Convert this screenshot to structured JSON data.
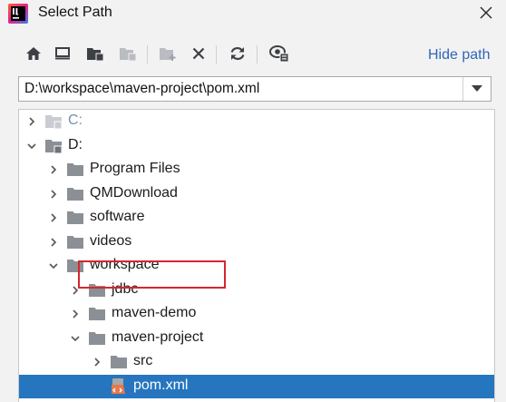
{
  "window": {
    "title": "Select Path",
    "close_icon": "close-icon"
  },
  "toolbar": {
    "buttons": [
      "home-icon",
      "desktop-icon",
      "project-folder-icon",
      "module-folder-icon",
      "new-folder-icon",
      "delete-icon",
      "refresh-icon",
      "show-hidden-icon"
    ],
    "hide_path_label": "Hide path"
  },
  "path_field": {
    "value": "D:\\workspace\\maven-project\\pom.xml"
  },
  "tree": {
    "items": [
      {
        "label": "C:",
        "state": "collapsed",
        "type": "drive",
        "dim": true
      },
      {
        "label": "D:",
        "state": "expanded",
        "type": "drive"
      },
      {
        "label": "Program Files",
        "state": "collapsed",
        "type": "folder"
      },
      {
        "label": "QMDownload",
        "state": "collapsed",
        "type": "folder"
      },
      {
        "label": "software",
        "state": "collapsed",
        "type": "folder"
      },
      {
        "label": "videos",
        "state": "collapsed",
        "type": "folder"
      },
      {
        "label": "workspace",
        "state": "expanded",
        "type": "folder"
      },
      {
        "label": "jdbc",
        "state": "collapsed",
        "type": "folder"
      },
      {
        "label": "maven-demo",
        "state": "collapsed",
        "type": "folder"
      },
      {
        "label": "maven-project",
        "state": "expanded",
        "type": "folder"
      },
      {
        "label": "src",
        "state": "collapsed",
        "type": "folder"
      },
      {
        "label": "pom.xml",
        "state": "selected",
        "type": "maven-file"
      }
    ]
  },
  "colors": {
    "selection": "#2675bf",
    "link": "#2f65b8",
    "folder": "#8a9096",
    "highlight_border": "#d7262e"
  }
}
